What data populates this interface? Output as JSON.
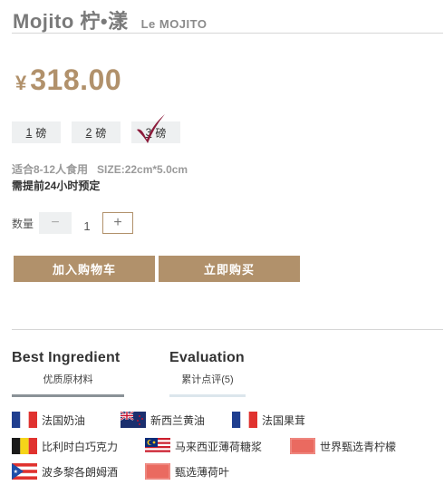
{
  "product": {
    "title": "Mojito 柠•漾",
    "subtitle": "Le MOJITO",
    "currency_symbol": "¥",
    "price": "318.00"
  },
  "sizes": [
    {
      "num": "1",
      "unit": "磅"
    },
    {
      "num": "2",
      "unit": "磅"
    },
    {
      "num": "3",
      "unit": "磅"
    }
  ],
  "selected_size_index": 2,
  "spec": {
    "serves": "适合8-12人食用",
    "dimensions": "SIZE:22cm*5.0cm",
    "preorder": "需提前24小时预定"
  },
  "quantity": {
    "label": "数量",
    "value": "1",
    "minus": "−",
    "plus": "+"
  },
  "actions": {
    "add_to_cart": "加入购物车",
    "buy_now": "立即购买"
  },
  "tabs": [
    {
      "title": "Best Ingredient",
      "sub": "优质原材料"
    },
    {
      "title": "Evaluation",
      "sub": "累计点评(5)"
    }
  ],
  "ingredients": [
    {
      "flag": "france-flag",
      "label": "法国奶油"
    },
    {
      "flag": "new-zealand-flag",
      "label": "新西兰黄油"
    },
    {
      "flag": "france-flag",
      "label": "法国果茸"
    },
    {
      "flag": "belgium-flag",
      "label": "比利时白巧克力"
    },
    {
      "flag": "malaysia-flag",
      "label": "马来西亚薄荷糖浆"
    },
    {
      "flag": "red-placeholder-flag",
      "label": "世界甄选青柠檬"
    },
    {
      "flag": "puerto-rico-flag",
      "label": "波多黎各朗姆酒"
    },
    {
      "flag": "red-placeholder-flag",
      "label": "甄选薄荷叶"
    }
  ],
  "colors": {
    "accent": "#b1916b",
    "checkmark": "#8b1a3a"
  }
}
